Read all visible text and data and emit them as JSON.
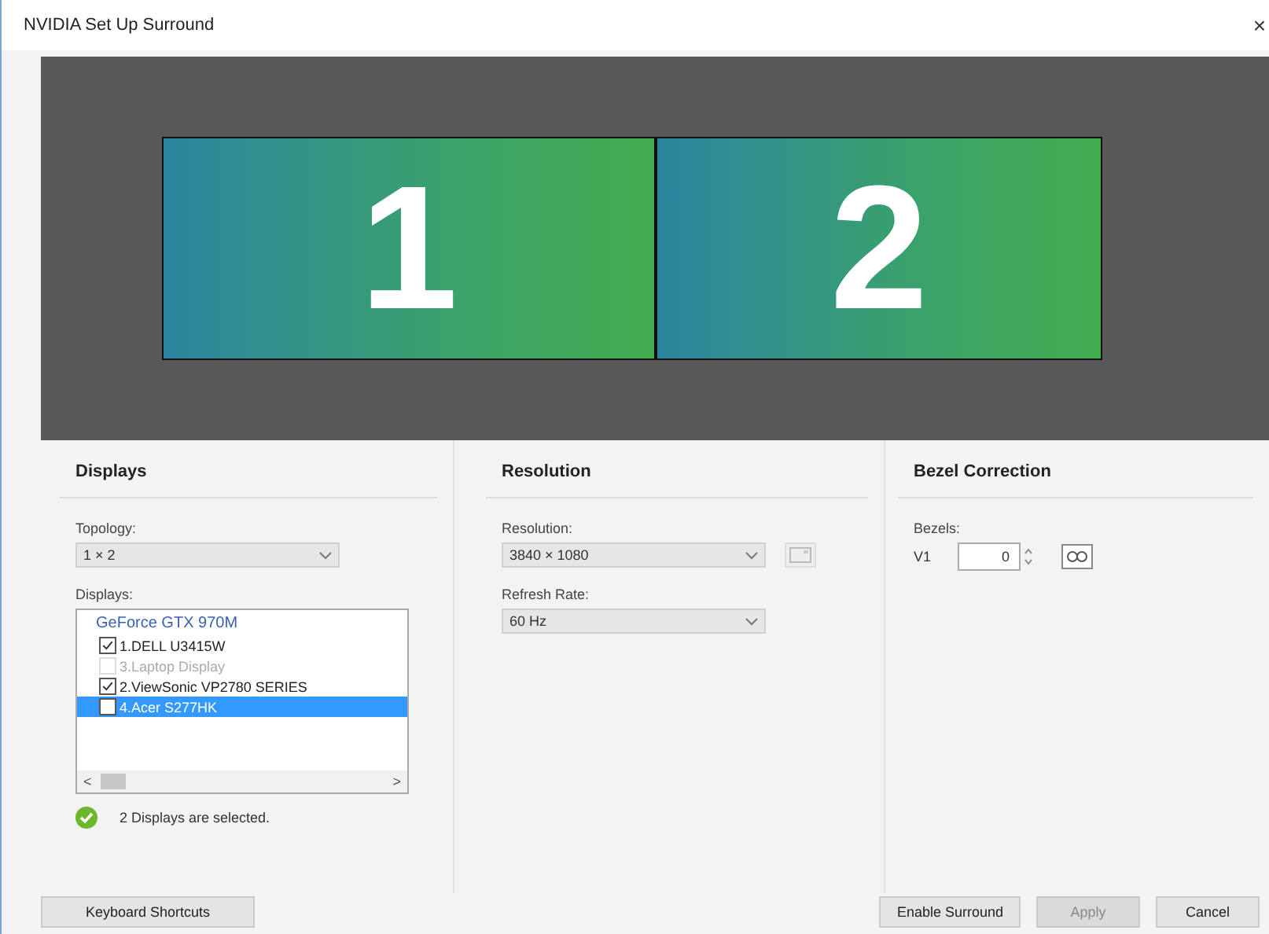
{
  "window": {
    "title": "NVIDIA Set Up Surround",
    "close": "×"
  },
  "preview": {
    "monitors": [
      {
        "label": "1"
      },
      {
        "label": "2"
      }
    ]
  },
  "displays_panel": {
    "heading": "Displays",
    "topology_label": "Topology:",
    "topology": "1 × 2",
    "displays_label": "Displays:",
    "gpu": "GeForce GTX 970M",
    "items": [
      {
        "label": "1.DELL U3415W",
        "checked": true,
        "disabled": false,
        "selected": false
      },
      {
        "label": "3.Laptop Display",
        "checked": false,
        "disabled": true,
        "selected": false
      },
      {
        "label": "2.ViewSonic VP2780 SERIES",
        "checked": true,
        "disabled": false,
        "selected": false
      },
      {
        "label": "4.Acer S277HK",
        "checked": false,
        "disabled": false,
        "selected": true
      }
    ],
    "scroll_left": "<",
    "scroll_right": ">",
    "status": "2 Displays are selected."
  },
  "resolution_panel": {
    "heading": "Resolution",
    "resolution_label": "Resolution:",
    "resolution": "3840 × 1080",
    "refresh_label": "Refresh Rate:",
    "refresh": "60 Hz"
  },
  "bezel_panel": {
    "heading": "Bezel Correction",
    "bezels_label": "Bezels:",
    "v_label": "V1",
    "value": "0"
  },
  "buttons": [
    {
      "label": "Keyboard Shortcuts",
      "disabled": false
    },
    {
      "label": "Enable Surround",
      "disabled": false
    },
    {
      "label": "Apply",
      "disabled": true
    },
    {
      "label": "Cancel",
      "disabled": false
    }
  ]
}
